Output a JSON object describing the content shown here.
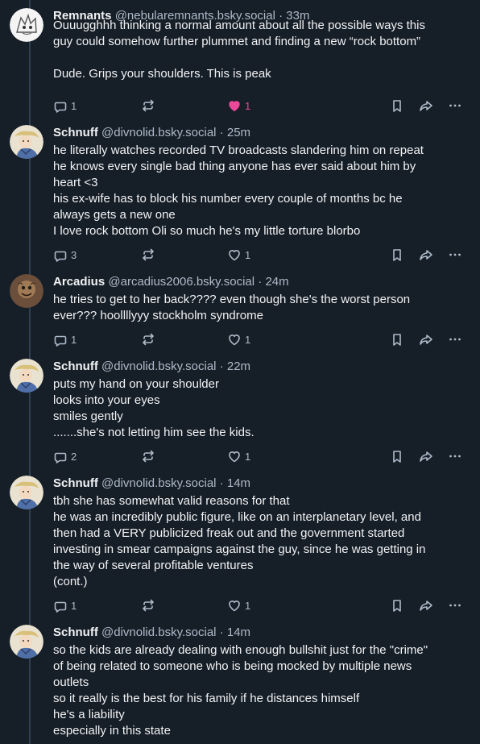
{
  "posts": [
    {
      "name": "Remnants",
      "handle": "@nebularemnants.bsky.social",
      "time": "33m",
      "avatar": "avatar-remnants",
      "lines": [
        "Ouuugghhh thinking a normal amount about all the possible ways this",
        "guy could somehow further plummet and finding a new “rock bottom”",
        "",
        "Dude. Grips your shoulders. This is peak"
      ],
      "replies": "1",
      "reposts": "",
      "likes": "1",
      "liked": true
    },
    {
      "name": "Schnuff",
      "handle": "@divnolid.bsky.social",
      "time": "25m",
      "avatar": "avatar-schnuff",
      "lines": [
        "he literally watches recorded TV broadcasts slandering him on repeat",
        "he knows every single bad thing anyone has ever said about him by",
        "heart <3",
        "his ex-wife has to block his number every couple of months bc he",
        "always gets a new one",
        "I love rock bottom Oli so much he's my little torture blorbo"
      ],
      "replies": "3",
      "reposts": "",
      "likes": "1",
      "liked": false
    },
    {
      "name": "Arcadius",
      "handle": "@arcadius2006.bsky.social",
      "time": "24m",
      "avatar": "avatar-arcadius",
      "lines": [
        "he tries to get to her back???? even though she's the worst person",
        "ever??? hoollllyyy stockholm syndrome"
      ],
      "replies": "1",
      "reposts": "",
      "likes": "1",
      "liked": false
    },
    {
      "name": "Schnuff",
      "handle": "@divnolid.bsky.social",
      "time": "22m",
      "avatar": "avatar-schnuff",
      "lines": [
        "puts my hand on your shoulder",
        "looks into your eyes",
        "smiles gently",
        ".......she's not letting him see the kids."
      ],
      "replies": "2",
      "reposts": "",
      "likes": "1",
      "liked": false
    },
    {
      "name": "Schnuff",
      "handle": "@divnolid.bsky.social",
      "time": "14m",
      "avatar": "avatar-schnuff",
      "lines": [
        "tbh she has somewhat valid reasons for that",
        "he was an incredibly public figure, like on an interplanetary level, and",
        "then had a VERY publicized freak out and the government started",
        "investing in smear campaigns against the guy, since he was getting in",
        "the way of several profitable ventures",
        "(cont.)"
      ],
      "replies": "1",
      "reposts": "",
      "likes": "1",
      "liked": false
    },
    {
      "name": "Schnuff",
      "handle": "@divnolid.bsky.social",
      "time": "14m",
      "avatar": "avatar-schnuff",
      "lines": [
        "so the kids are already dealing with enough bullshit just for the \"crime\"",
        "of being related to someone who is being mocked by multiple news",
        "outlets",
        "so it really is the best for his family if he distances himself",
        "he's a liability",
        "especially in this state"
      ],
      "replies": "",
      "reposts": "",
      "likes": "",
      "liked": false
    }
  ],
  "dot": "·",
  "colors": {
    "background": "#161e27",
    "text": "#f1f3f5",
    "muted": "#aebbc9",
    "like": "#ec4899",
    "thread": "#2e4052"
  },
  "icons": {
    "reply": "reply-bubble-icon",
    "repost": "repost-icon",
    "like": "heart-icon",
    "bookmark": "bookmark-icon",
    "share": "share-arrow-icon",
    "more": "more-dots-icon"
  }
}
